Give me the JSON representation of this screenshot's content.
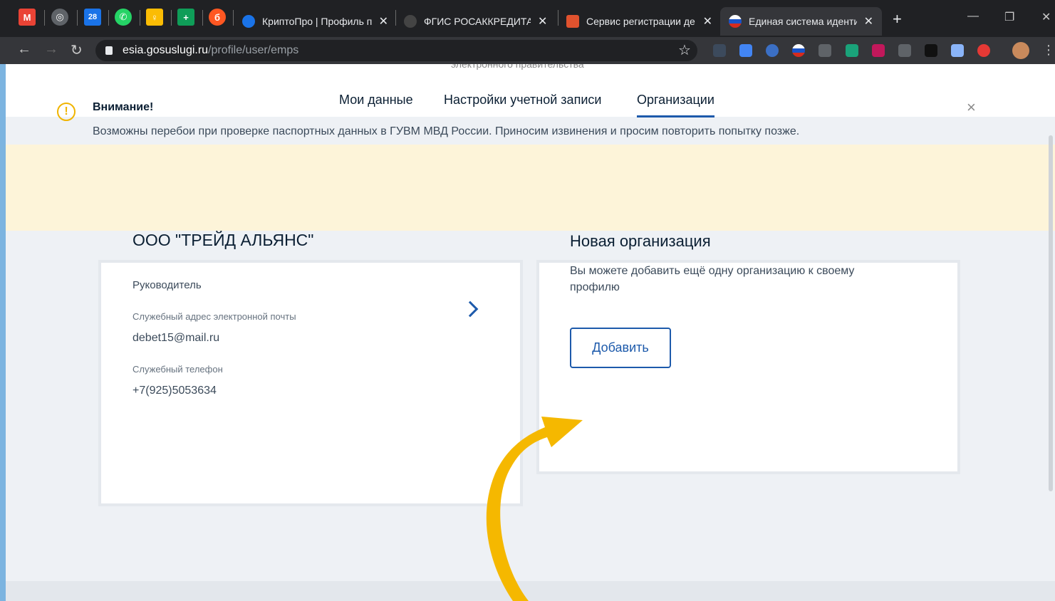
{
  "browser": {
    "tabs": [
      {
        "title": "КриптоПро | Профиль п",
        "active": false
      },
      {
        "title": "ФГИС РОСАККРЕДИТАЦ",
        "active": false
      },
      {
        "title": "Сервис регистрации де",
        "active": false
      },
      {
        "title": "Единая система иденти",
        "active": true
      }
    ],
    "pinned": [
      "gmail",
      "globe",
      "calendar-28",
      "whatsapp",
      "keep",
      "sheets",
      "beta"
    ],
    "calendar_day": "28",
    "new_tab": "+",
    "url_host": "esia.gosuslugi.ru",
    "url_path": "/profile/user/emps"
  },
  "header": {
    "cutoff_text": "электронного правительства",
    "nav": [
      {
        "label": "Мои данные",
        "active": false
      },
      {
        "label": "Настройки учетной записи",
        "active": false
      },
      {
        "label": "Организации",
        "active": true
      }
    ]
  },
  "alert": {
    "title": "Внимание!",
    "text": "Возможны перебои при проверке паспортных данных в ГУВМ МВД России. Приносим извинения и просим повторить попытку позже.",
    "icon": "warning-icon",
    "close": "×"
  },
  "org_card": {
    "name": "ООО \"ТРЕЙД АЛЬЯНС\"",
    "role": "Руководитель",
    "email_label": "Служебный адрес электронной почты",
    "email": "debet15@mail.ru",
    "phone_label": "Служебный телефон",
    "phone": "+7(925)5053634"
  },
  "new_org_card": {
    "title": "Новая организация",
    "description": "Вы можете добавить ещё одну организацию к своему профилю",
    "button": "Добавить"
  },
  "colors": {
    "accent": "#1d5aab",
    "alert_bg": "#fdf4d9",
    "annotation_arrow": "#f5b800"
  }
}
